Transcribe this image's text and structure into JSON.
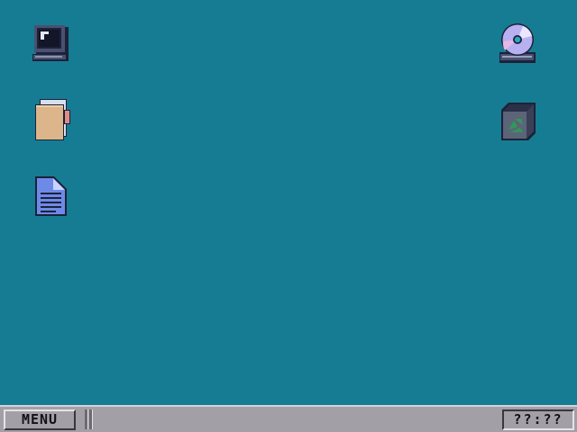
{
  "desktop": {
    "background": "#167c93",
    "icons": {
      "computer": "computer-icon",
      "folder": "folder-icon",
      "document": "document-icon",
      "cd": "cd-drive-icon",
      "recycle": "recycle-bin-icon"
    }
  },
  "taskbar": {
    "menu_label": "MENU",
    "clock": "??:??"
  }
}
